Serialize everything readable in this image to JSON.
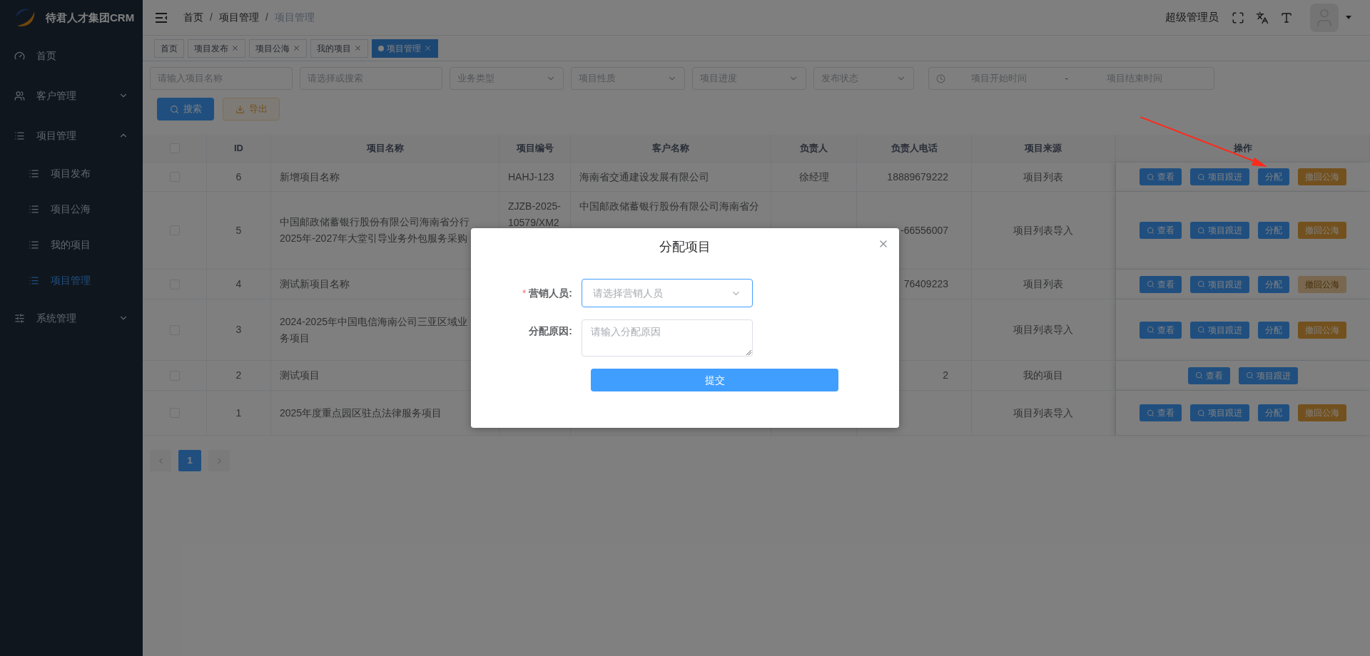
{
  "app": {
    "title": "待君人才集团CRM"
  },
  "sidebar": {
    "items": [
      {
        "label": "首页",
        "selected": false
      },
      {
        "label": "客户管理",
        "selected": false,
        "expanded": false
      },
      {
        "label": "项目管理",
        "selected": false,
        "expanded": true,
        "children": [
          {
            "label": "项目发布",
            "selected": false
          },
          {
            "label": "项目公海",
            "selected": false
          },
          {
            "label": "我的项目",
            "selected": false
          },
          {
            "label": "项目管理",
            "selected": true
          }
        ]
      },
      {
        "label": "系统管理",
        "selected": false,
        "expanded": false
      }
    ]
  },
  "header": {
    "breadcrumb": [
      "首页",
      "项目管理",
      "项目管理"
    ],
    "breadcrumb_separators": [
      "/",
      "/"
    ],
    "user": "超级管理员"
  },
  "tabs": [
    {
      "label": "首页",
      "selected": false,
      "closable": false
    },
    {
      "label": "项目发布",
      "selected": false,
      "closable": true
    },
    {
      "label": "项目公海",
      "selected": false,
      "closable": true
    },
    {
      "label": "我的项目",
      "selected": false,
      "closable": true
    },
    {
      "label": "项目管理",
      "selected": true,
      "closable": true
    }
  ],
  "filters": [
    {
      "kind": "input",
      "placeholder": "请输入项目名称"
    },
    {
      "kind": "input",
      "placeholder": "请选择或搜索"
    },
    {
      "kind": "select",
      "placeholder": "业务类型"
    },
    {
      "kind": "select",
      "placeholder": "项目性质"
    },
    {
      "kind": "select",
      "placeholder": "项目进度"
    },
    {
      "kind": "select",
      "placeholder": "发布状态"
    },
    {
      "kind": "daterange",
      "start_placeholder": "项目开始时间",
      "separator": "-",
      "end_placeholder": "项目结束时间"
    }
  ],
  "actions": [
    {
      "kind": "search",
      "label": "搜索"
    },
    {
      "kind": "export",
      "label": "导出"
    }
  ],
  "table": {
    "select_all": {
      "checked": false
    },
    "columns": [
      "ID",
      "项目名称",
      "项目编号",
      "客户名称",
      "负责人",
      "负责人电话",
      "项目来源",
      "操作"
    ],
    "rows": [
      {
        "checked": false,
        "id": "6",
        "name": [
          "新增项目名称"
        ],
        "code": [
          "HAHJ-123"
        ],
        "customer": [
          "海南省交通建设发展有限公司"
        ],
        "owner": "徐经理",
        "phone": "18889679222",
        "source": "项目列表",
        "actions": [
          {
            "kind": "search",
            "label": "查看",
            "disabled": false
          },
          {
            "kind": "search",
            "label": "项目跟进",
            "disabled": false
          },
          {
            "kind": "primary",
            "label": "分配",
            "disabled": false
          },
          {
            "kind": "warning",
            "label": "撤回公海",
            "disabled": false
          }
        ]
      },
      {
        "checked": false,
        "id": "5",
        "name": [
          "中国邮政储蓄银行股份有限公司海南省分行",
          "2025年-2027年大堂引导业务外包服务采购"
        ],
        "code": [
          "ZJZB-2025-",
          "10579/XM2"
        ],
        "customer": [
          "中国邮政储蓄银行股份有限公司海南省分"
        ],
        "phone": "-66556007",
        "source": "项目列表导入",
        "actions": [
          {
            "kind": "search",
            "label": "查看",
            "disabled": false
          },
          {
            "kind": "search",
            "label": "项目跟进",
            "disabled": false
          },
          {
            "kind": "primary",
            "label": "分配",
            "disabled": false
          },
          {
            "kind": "warning",
            "label": "撤回公海",
            "disabled": false
          }
        ]
      },
      {
        "checked": false,
        "id": "4",
        "name": [
          "测试新项目名称"
        ],
        "phone": "76409223",
        "source": "项目列表",
        "actions": [
          {
            "kind": "search",
            "label": "查看",
            "disabled": false
          },
          {
            "kind": "search",
            "label": "项目跟进",
            "disabled": false
          },
          {
            "kind": "primary",
            "label": "分配",
            "disabled": false
          },
          {
            "kind": "warning",
            "label": "撤回公海",
            "disabled": true
          }
        ]
      },
      {
        "checked": false,
        "id": "3",
        "name": [
          "2024-2025年中国电信海南公司三亚区域业",
          "务项目"
        ],
        "source": "项目列表导入",
        "actions": [
          {
            "kind": "search",
            "label": "查看",
            "disabled": false
          },
          {
            "kind": "search",
            "label": "项目跟进",
            "disabled": false
          },
          {
            "kind": "primary",
            "label": "分配",
            "disabled": false
          },
          {
            "kind": "warning",
            "label": "撤回公海",
            "disabled": false
          }
        ]
      },
      {
        "checked": false,
        "id": "2",
        "name": [
          "测试项目"
        ],
        "phone": "2",
        "source": "我的项目",
        "actions": [
          {
            "kind": "search",
            "label": "查看",
            "disabled": false
          },
          {
            "kind": "search",
            "label": "项目跟进",
            "disabled": false
          }
        ]
      },
      {
        "checked": false,
        "id": "1",
        "name": [
          "2025年度重点园区驻点法律服务项目"
        ],
        "source": "项目列表导入",
        "actions": [
          {
            "kind": "search",
            "label": "查看",
            "disabled": false
          },
          {
            "kind": "search",
            "label": "项目跟进",
            "disabled": false
          },
          {
            "kind": "primary",
            "label": "分配",
            "disabled": false
          },
          {
            "kind": "warning",
            "label": "撤回公海",
            "disabled": false
          }
        ]
      }
    ]
  },
  "pagination": {
    "prev_disabled": true,
    "next_disabled": true,
    "pages": [
      {
        "label": "1",
        "selected": true
      }
    ]
  },
  "dialog": {
    "title": "分配项目",
    "fields": [
      {
        "kind": "select",
        "label": "营销人员:",
        "required": true,
        "focused": true,
        "placeholder": "请选择营销人员"
      },
      {
        "kind": "textarea",
        "label": "分配原因:",
        "required": false,
        "focused": false,
        "placeholder": "请输入分配原因"
      }
    ],
    "required_mark": "*",
    "submit": "提交"
  }
}
